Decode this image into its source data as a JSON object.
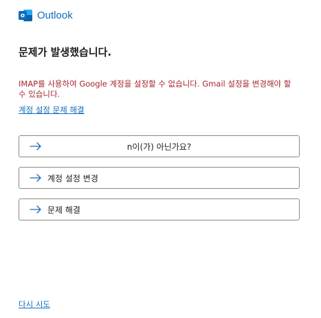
{
  "brand": {
    "name": "Outlook",
    "logo_letter": "o",
    "accent_color": "#0f6cbd"
  },
  "title": "문제가 발생했습니다.",
  "error": {
    "message": "IMAP를 사용하여 Google 계정을 설정할 수 없습니다. Gmail 설정을 변경해야 할 수 있습니다.",
    "color": "#a4262c"
  },
  "links": {
    "troubleshoot": "계정 설정 문제 해결",
    "retry": "다시 시도"
  },
  "actions": [
    {
      "label": "n이(가) 아닌가요?",
      "icon": "arrow-right-icon"
    },
    {
      "label": "계정 설정 변경",
      "icon": "arrow-right-icon"
    },
    {
      "label": "문제 해결",
      "icon": "arrow-right-icon"
    }
  ]
}
